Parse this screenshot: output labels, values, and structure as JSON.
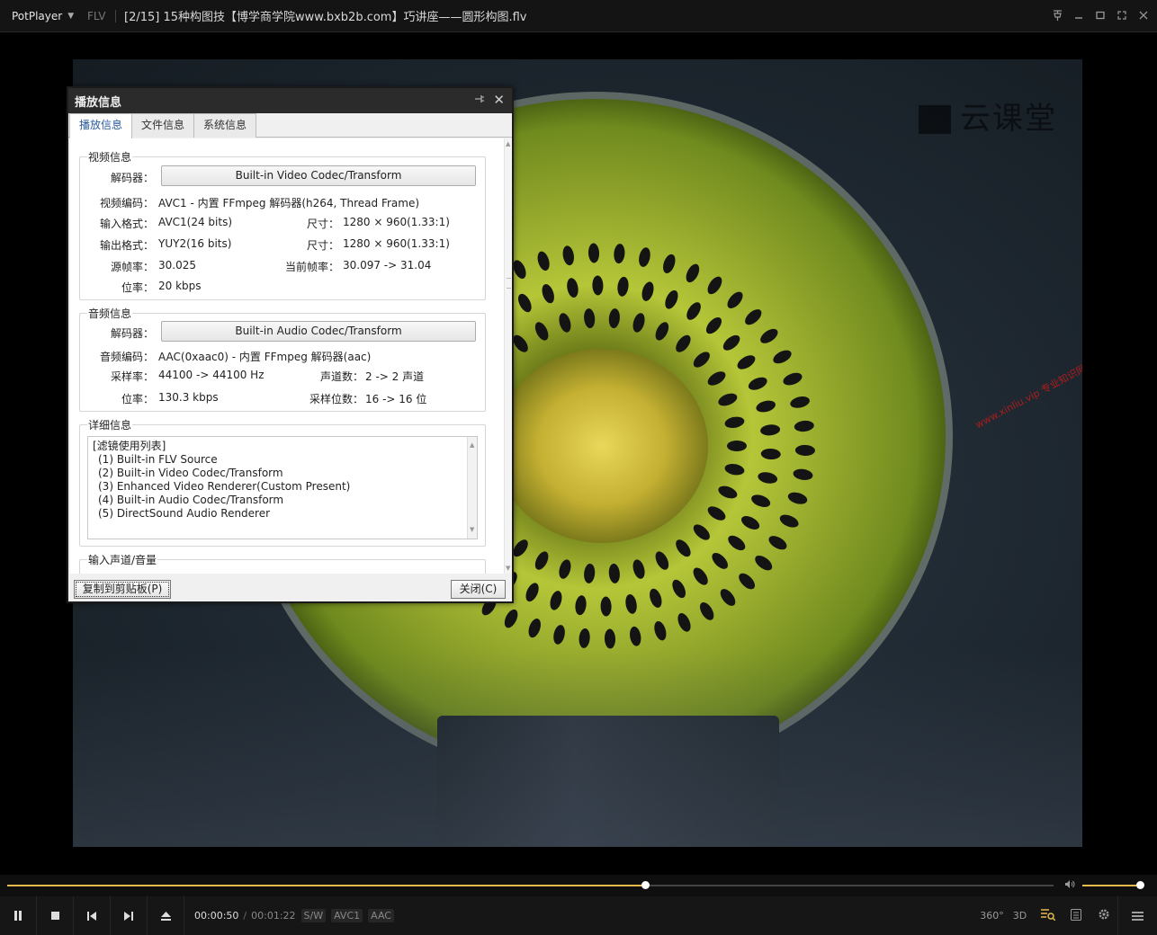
{
  "titlebar": {
    "app_name": "PotPlayer",
    "format": "FLV",
    "title": "[2/15] 15种构图技【博学商学院www.bxb2b.com】巧讲座——圆形构图.flv"
  },
  "video": {
    "watermark": "云课堂",
    "red_watermark": "www.xinliu.vip 专业知识网站"
  },
  "dialog": {
    "title": "播放信息",
    "tabs": [
      "播放信息",
      "文件信息",
      "系统信息"
    ],
    "video_info": {
      "group_title": "视频信息",
      "decoder_label": "解码器：",
      "decoder_value": "Built-in Video Codec/Transform",
      "codec_label": "视频编码：",
      "codec_value": "AVC1 - 内置 FFmpeg 解码器(h264, Thread Frame)",
      "input_format_label": "输入格式：",
      "input_format_value": "AVC1(24 bits)",
      "input_size_label": "尺寸：",
      "input_size_value": "1280 × 960(1.33:1)",
      "output_format_label": "输出格式：",
      "output_format_value": "YUY2(16 bits)",
      "output_size_label": "尺寸：",
      "output_size_value": "1280 × 960(1.33:1)",
      "src_fps_label": "源帧率：",
      "src_fps_value": "30.025",
      "cur_fps_label": "当前帧率：",
      "cur_fps_value": "30.097 -> 31.04",
      "bitrate_label": "位率：",
      "bitrate_value": "20 kbps"
    },
    "audio_info": {
      "group_title": "音频信息",
      "decoder_label": "解码器：",
      "decoder_value": "Built-in Audio Codec/Transform",
      "codec_label": "音频编码：",
      "codec_value": "AAC(0xaac0) - 内置 FFmpeg 解码器(aac)",
      "sample_rate_label": "采样率：",
      "sample_rate_value": "44100 -> 44100 Hz",
      "channels_label": "声道数：",
      "channels_value": "2 -> 2 声道",
      "bitrate_label": "位率：",
      "bitrate_value": "130.3 kbps",
      "bits_label": "采样位数：",
      "bits_value": "16 -> 16 位"
    },
    "detail_info": {
      "group_title": "详细信息",
      "lines": [
        "[滤镜使用列表]",
        "(1) Built-in FLV Source",
        "(2) Built-in Video Codec/Transform",
        "(3) Enhanced Video Renderer(Custom Present)",
        "(4) Built-in Audio Codec/Transform",
        "(5) DirectSound Audio Renderer"
      ]
    },
    "input_channel": {
      "group_title": "输入声道/音量"
    },
    "copy_button": "复制到剪贴板(P)",
    "close_button": "关闭(C)"
  },
  "playback": {
    "current_time": "00:00:50",
    "separator": "/",
    "duration": "00:01:22",
    "progress_fraction": 0.61,
    "volume_fraction": 0.97,
    "badges": [
      "S/W",
      "AVC1",
      "AAC"
    ]
  },
  "controls": {
    "right_icons": [
      "360°",
      "3D"
    ]
  },
  "colors": {
    "accent": "#e6b94a",
    "titlebar_bg": "#141414",
    "dialog_title_bg": "#2b2b2b",
    "active_tab_text": "#2b5b9a"
  }
}
